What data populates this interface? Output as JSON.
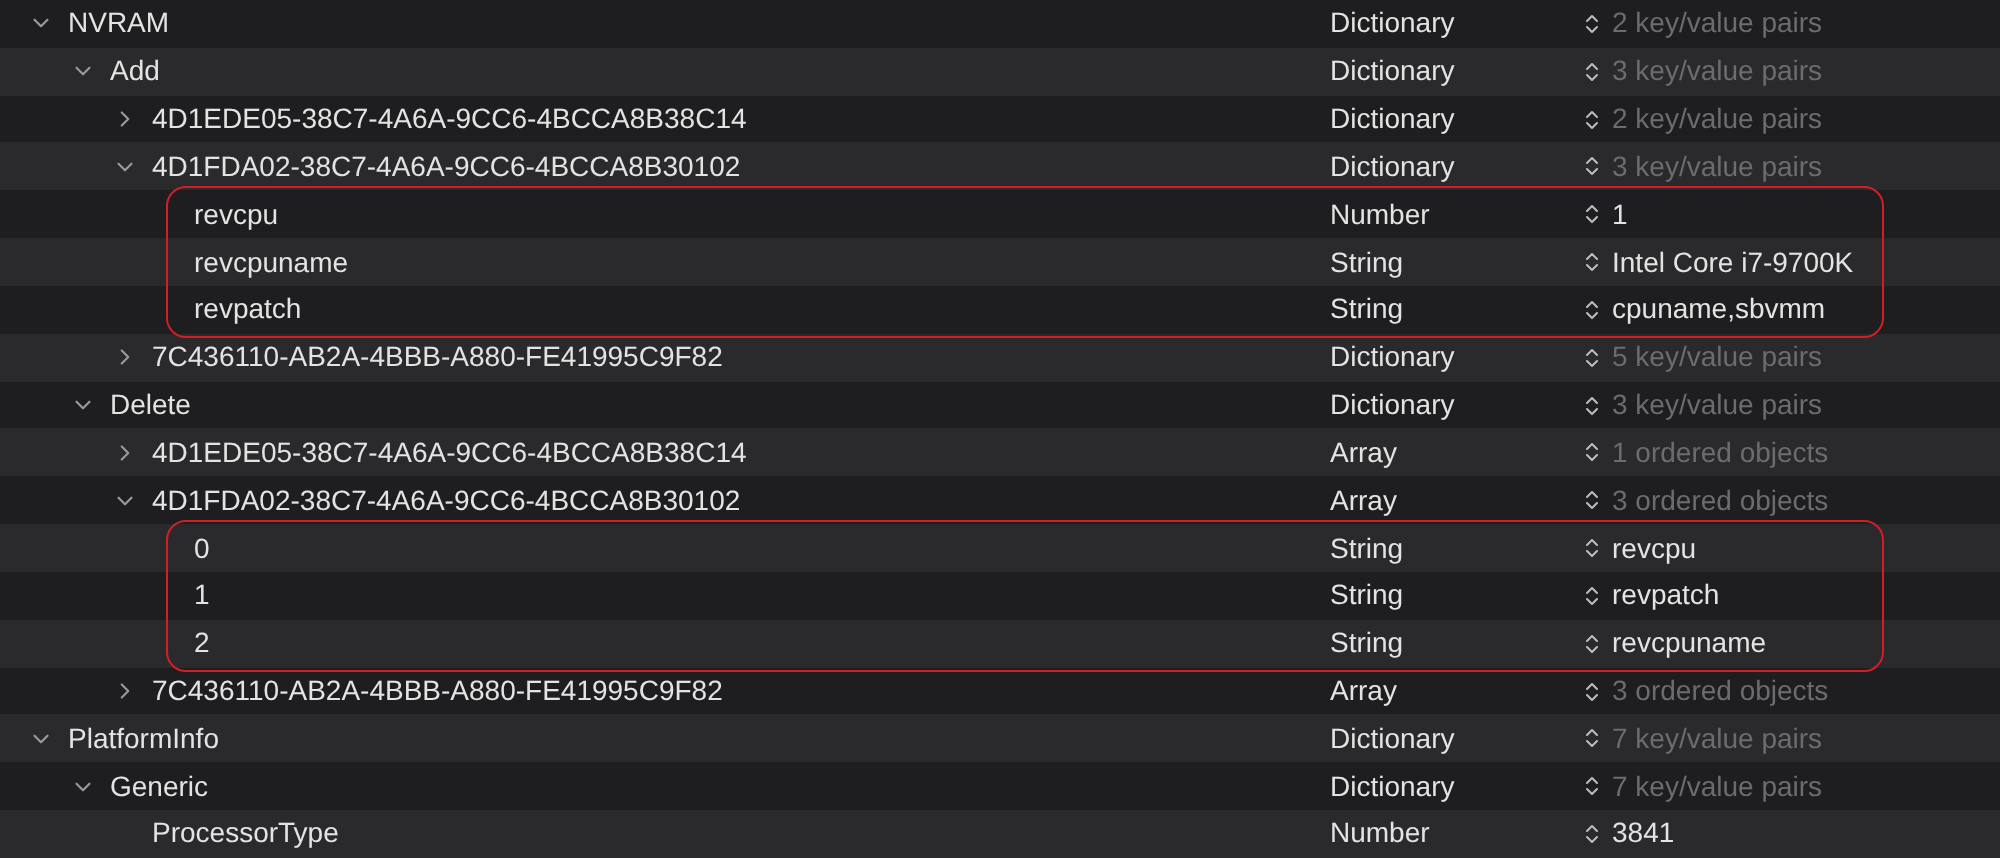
{
  "rows": [
    {
      "key": "NVRAM",
      "kind": "container",
      "expanded": true,
      "highlighted": false,
      "type": "Dictionary",
      "value": "2 key/value pairs",
      "children": [
        {
          "key": "Add",
          "kind": "container",
          "expanded": true,
          "highlighted": false,
          "type": "Dictionary",
          "value": "3 key/value pairs",
          "children": [
            {
              "key": "4D1EDE05-38C7-4A6A-9CC6-4BCCA8B38C14",
              "kind": "container",
              "expanded": false,
              "highlighted": false,
              "type": "Dictionary",
              "value": "2 key/value pairs"
            },
            {
              "key": "4D1FDA02-38C7-4A6A-9CC6-4BCCA8B30102",
              "kind": "container",
              "expanded": true,
              "highlighted": false,
              "type": "Dictionary",
              "value": "3 key/value pairs",
              "children": [
                {
                  "key": "revcpu",
                  "kind": "leaf",
                  "highlighted": true,
                  "type": "Number",
                  "value": "1"
                },
                {
                  "key": "revcpuname",
                  "kind": "leaf",
                  "highlighted": true,
                  "type": "String",
                  "value": "Intel Core i7-9700K"
                },
                {
                  "key": "revpatch",
                  "kind": "leaf",
                  "highlighted": true,
                  "type": "String",
                  "value": "cpuname,sbvmm"
                }
              ]
            },
            {
              "key": "7C436110-AB2A-4BBB-A880-FE41995C9F82",
              "kind": "container",
              "expanded": false,
              "highlighted": false,
              "type": "Dictionary",
              "value": "5 key/value pairs"
            }
          ]
        },
        {
          "key": "Delete",
          "kind": "container",
          "expanded": true,
          "highlighted": false,
          "type": "Dictionary",
          "value": "3 key/value pairs",
          "children": [
            {
              "key": "4D1EDE05-38C7-4A6A-9CC6-4BCCA8B38C14",
              "kind": "container",
              "expanded": false,
              "highlighted": false,
              "type": "Array",
              "value": "1 ordered objects"
            },
            {
              "key": "4D1FDA02-38C7-4A6A-9CC6-4BCCA8B30102",
              "kind": "container",
              "expanded": true,
              "highlighted": false,
              "type": "Array",
              "value": "3 ordered objects",
              "children": [
                {
                  "key": "0",
                  "kind": "leaf",
                  "highlighted": true,
                  "type": "String",
                  "value": "revcpu"
                },
                {
                  "key": "1",
                  "kind": "leaf",
                  "highlighted": true,
                  "type": "String",
                  "value": "revpatch"
                },
                {
                  "key": "2",
                  "kind": "leaf",
                  "highlighted": true,
                  "type": "String",
                  "value": "revcpuname"
                }
              ]
            },
            {
              "key": "7C436110-AB2A-4BBB-A880-FE41995C9F82",
              "kind": "container",
              "expanded": false,
              "highlighted": false,
              "type": "Array",
              "value": "3 ordered objects"
            }
          ]
        }
      ]
    },
    {
      "key": "PlatformInfo",
      "kind": "container",
      "expanded": true,
      "highlighted": false,
      "type": "Dictionary",
      "value": "7 key/value pairs",
      "children": [
        {
          "key": "Generic",
          "kind": "container",
          "expanded": true,
          "highlighted": false,
          "type": "Dictionary",
          "value": "7 key/value pairs",
          "children": [
            {
              "key": "ProcessorType",
              "kind": "leaf",
              "highlighted": false,
              "type": "Number",
              "value": "3841"
            }
          ]
        }
      ]
    }
  ]
}
